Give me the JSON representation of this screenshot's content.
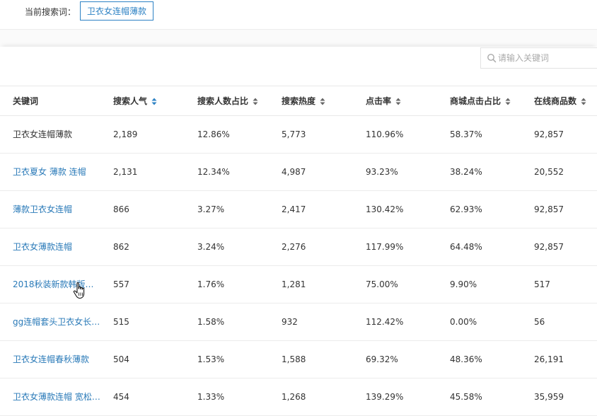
{
  "header": {
    "current_label": "当前搜索词：",
    "current_term": "卫衣女连帽薄款"
  },
  "search": {
    "placeholder": "请输入关键词",
    "value": ""
  },
  "table": {
    "columns": [
      {
        "label": "关键词",
        "sortable": false
      },
      {
        "label": "搜索人气",
        "sortable": true,
        "sort": "desc"
      },
      {
        "label": "搜索人数占比",
        "sortable": true,
        "sort": "none"
      },
      {
        "label": "搜索热度",
        "sortable": true,
        "sort": "none"
      },
      {
        "label": "点击率",
        "sortable": true,
        "sort": "none"
      },
      {
        "label": "商城点击占比",
        "sortable": true,
        "sort": "none"
      },
      {
        "label": "在线商品数",
        "sortable": true,
        "sort": "none"
      }
    ],
    "rows": [
      {
        "keyword": "卫衣女连帽薄款",
        "popularity": "2,189",
        "share": "12.86%",
        "heat": "5,773",
        "ctr": "110.96%",
        "mall_ratio": "58.37%",
        "online": "92,857",
        "link": false
      },
      {
        "keyword": "卫衣夏女 薄款 连帽",
        "popularity": "2,131",
        "share": "12.34%",
        "heat": "4,987",
        "ctr": "93.23%",
        "mall_ratio": "38.24%",
        "online": "20,552",
        "link": true
      },
      {
        "keyword": "薄款卫衣女连帽",
        "popularity": "866",
        "share": "3.27%",
        "heat": "2,417",
        "ctr": "130.42%",
        "mall_ratio": "62.93%",
        "online": "92,857",
        "link": true
      },
      {
        "keyword": "卫衣女薄款连帽",
        "popularity": "862",
        "share": "3.24%",
        "heat": "2,276",
        "ctr": "117.99%",
        "mall_ratio": "64.48%",
        "online": "92,857",
        "link": true
      },
      {
        "keyword": "2018秋装新款韩版卫衣女连帽...",
        "popularity": "557",
        "share": "1.76%",
        "heat": "1,281",
        "ctr": "75.00%",
        "mall_ratio": "9.90%",
        "online": "517",
        "link": true
      },
      {
        "keyword": "gg连帽套头卫衣女长款薄款",
        "popularity": "515",
        "share": "1.58%",
        "heat": "932",
        "ctr": "112.42%",
        "mall_ratio": "0.00%",
        "online": "56",
        "link": true
      },
      {
        "keyword": "卫衣女连帽春秋薄款",
        "popularity": "504",
        "share": "1.53%",
        "heat": "1,588",
        "ctr": "69.32%",
        "mall_ratio": "48.36%",
        "online": "26,191",
        "link": true
      },
      {
        "keyword": "卫衣女薄款连帽 宽松 韩版",
        "popularity": "454",
        "share": "1.33%",
        "heat": "1,268",
        "ctr": "139.29%",
        "mall_ratio": "45.58%",
        "online": "35,959",
        "link": true
      }
    ]
  },
  "colors": {
    "link": "#2a7ab8",
    "accent_border": "#2d82c4",
    "sort_active": "#2d82c4",
    "sort_inactive": "#666666"
  }
}
